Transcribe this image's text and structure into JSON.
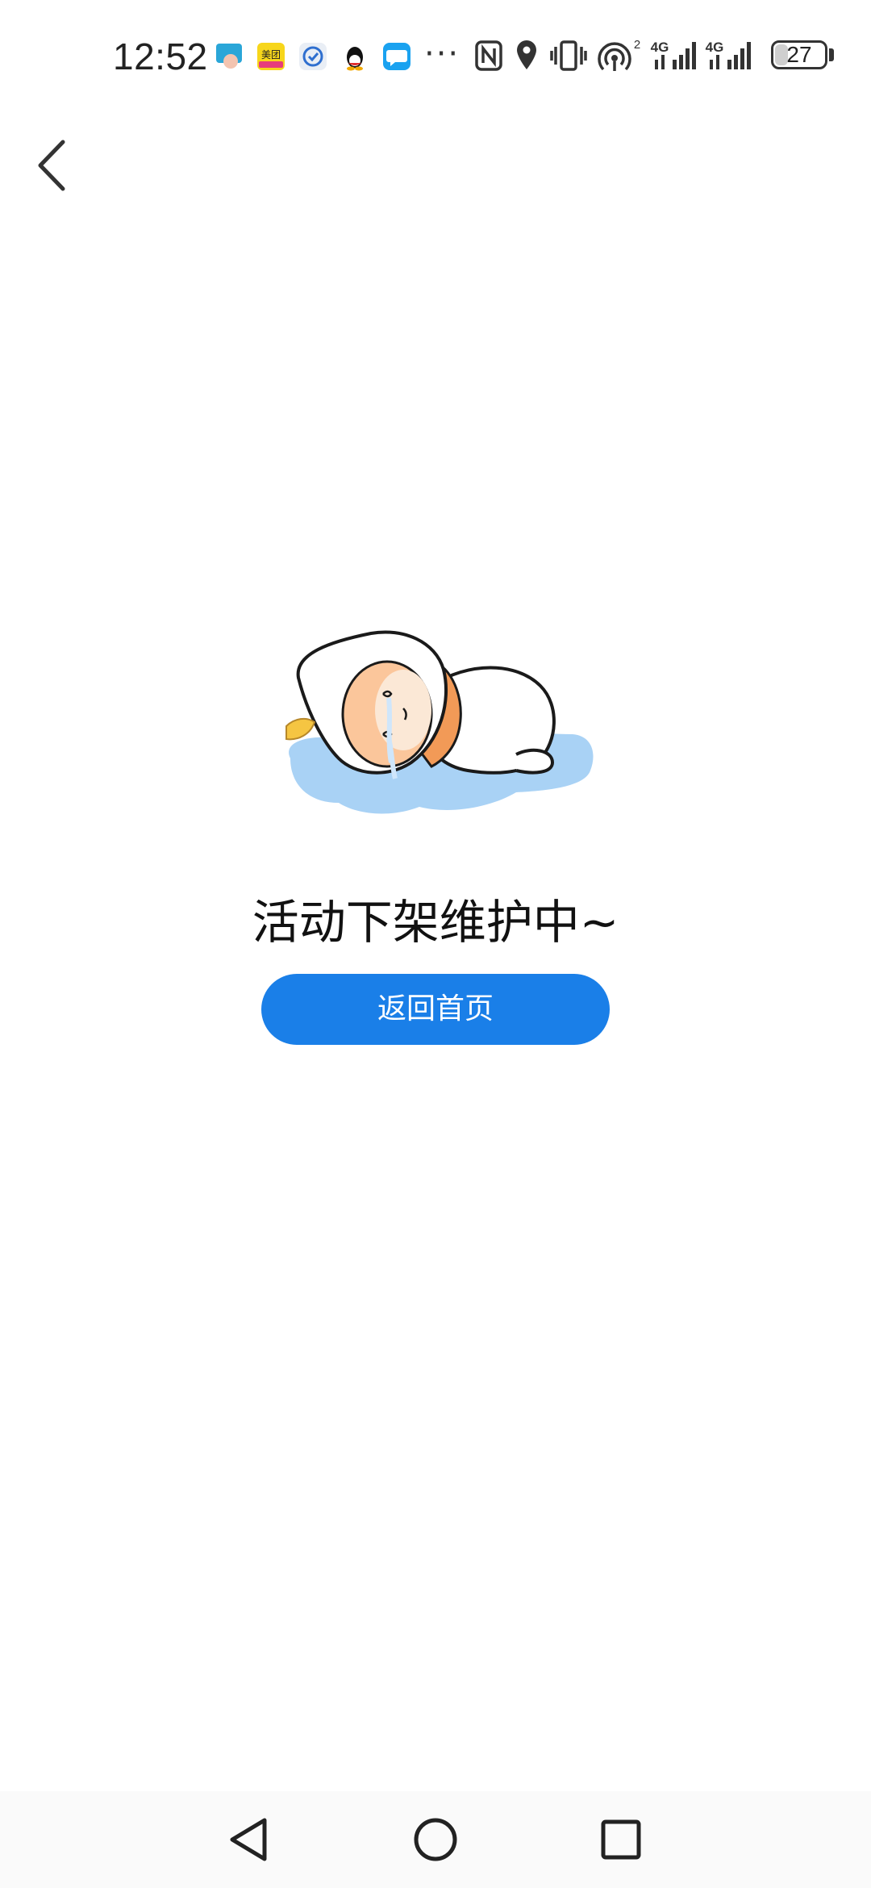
{
  "status_bar": {
    "time": "12:52",
    "overflow_indicator": "···",
    "battery_level": "27",
    "battery_fraction": 0.27,
    "icons": [
      "touch-app-icon",
      "meituan-app-icon",
      "browser-app-icon",
      "qq-app-icon",
      "message-app-icon",
      "nfc-icon",
      "location-icon",
      "vibrate-icon",
      "hotspot-icon",
      "signal-4g-icon",
      "signal-4g-icon"
    ],
    "hotspot_count": "2",
    "network_label_1": "4G",
    "network_label_2": "4G"
  },
  "header": {
    "back_icon": "chevron-left-icon"
  },
  "empty_state": {
    "illustration": "sleeping-egg-character",
    "message": "活动下架维护中~",
    "button_label": "返回首页"
  },
  "nav_bar": {
    "back": "triangle-back-icon",
    "home": "circle-home-icon",
    "recents": "square-recents-icon"
  },
  "colors": {
    "accent": "#1a7fe8",
    "puddle": "#a9d2f5"
  }
}
